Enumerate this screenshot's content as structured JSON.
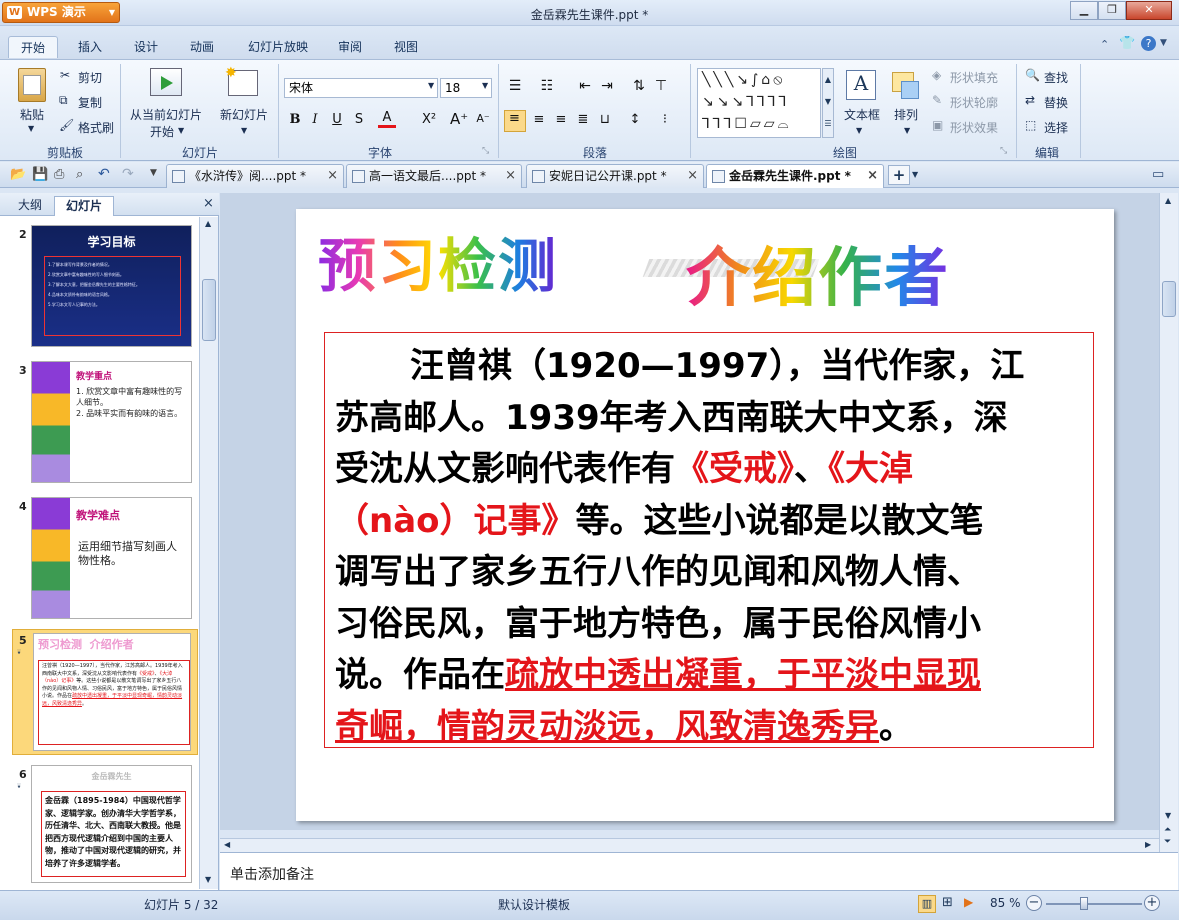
{
  "app": {
    "brand": "WPS 演示",
    "title": "金岳霖先生课件.ppt *"
  },
  "menu": {
    "tabs": [
      "开始",
      "插入",
      "设计",
      "动画",
      "幻灯片放映",
      "审阅",
      "视图"
    ]
  },
  "ribbon": {
    "clipboard": {
      "paste": "粘贴",
      "cut": "剪切",
      "copy": "复制",
      "format_painter": "格式刷",
      "label": "剪贴板"
    },
    "slides": {
      "from_current": "从当前幻灯片",
      "start": "开始",
      "new_slide": "新幻灯片",
      "label": "幻灯片"
    },
    "font": {
      "name": "宋体",
      "size": "18",
      "label": "字体"
    },
    "paragraph": {
      "label": "段落"
    },
    "drawing": {
      "textbox": "文本框",
      "arrange": "排列",
      "shape_fill": "形状填充",
      "shape_outline": "形状轮廓",
      "shape_effect": "形状效果",
      "label": "绘图"
    },
    "editing": {
      "find": "查找",
      "replace": "替换",
      "select": "选择",
      "label": "编辑"
    }
  },
  "doc_tabs": [
    "《水浒传》阅....ppt *",
    "高一语文最后....ppt *",
    "安妮日记公开课.ppt *",
    "金岳霖先生课件.ppt *"
  ],
  "left_pane": {
    "tabs": [
      "大纲",
      "幻灯片"
    ],
    "slides": [
      {
        "num": "2",
        "title": "学习目标",
        "lines": [
          "1.了解本课写作背景及作者的情况。",
          "2.欣赏文章中富有趣味性的写人细节刻画。",
          "3.了解本文大意，把握金岳霖先生的主要性格特征。",
          "4.品味本文质朴有韵味的语言风格。",
          "5.学习本文写人记事的方法。"
        ]
      },
      {
        "num": "3",
        "title": "教学重点",
        "lines": [
          "1. 欣赏文章中富有趣味性的写人细节。",
          "2. 品味平实而有韵味的语言。"
        ]
      },
      {
        "num": "4",
        "title": "教学难点",
        "lines": [
          "运用细节描写刻画人物性格。"
        ]
      },
      {
        "num": "5",
        "title": "预习检测  介绍作者"
      },
      {
        "num": "6",
        "title": "金岳霖先生",
        "text": "金岳霖（1895-1984）中国现代哲学家、逻辑学家。创办清华大学哲学系，历任清华、北大、西南联大教授。他是把西方现代逻辑介绍到中国的主要人物，推动了中国对现代逻辑的研究，并培养了许多逻辑学者。"
      }
    ]
  },
  "slide": {
    "title_left": "预习检测",
    "title_right": "介绍作者",
    "body": {
      "l1": "汪曾祺（1920—1997），当代作家，江",
      "l2": "苏高邮人。1939年考入西南联大中文系，深",
      "l3a": "受沈从文影响代表作有",
      "l3b": "《受戒》",
      "l3c": "、",
      "l3d": "《大淖",
      "l4a": "（nào）记事》",
      "l4b": "等。这些小说都是以散文笔",
      "l5": "调写出了家乡五行八作的见闻和风物人情、",
      "l6": "习俗民风，富于地方特色，属于民俗风情小",
      "l7a": "说。作品在",
      "l7b": "疏放中透出凝重，于平淡中显现",
      "l8a": "奇崛，情韵灵动淡远，风致清逸秀异",
      "l8b": "。"
    }
  },
  "notes": {
    "placeholder": "单击添加备注"
  },
  "status": {
    "slide": "幻灯片 5 / 32",
    "template": "默认设计模板",
    "zoom": "85 %"
  },
  "colors": {
    "accent_red": "#e4151a",
    "orange": "#e2731a"
  }
}
